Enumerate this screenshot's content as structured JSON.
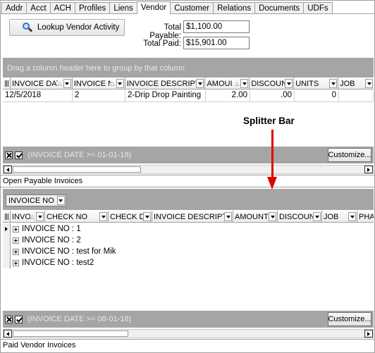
{
  "tabs": [
    {
      "label": "Addr",
      "active": false
    },
    {
      "label": "Acct",
      "active": false
    },
    {
      "label": "ACH",
      "active": false
    },
    {
      "label": "Profiles",
      "active": false
    },
    {
      "label": "Liens",
      "active": false
    },
    {
      "label": "Vendor",
      "active": true
    },
    {
      "label": "Customer",
      "active": false
    },
    {
      "label": "Relations",
      "active": false
    },
    {
      "label": "Documents",
      "active": false
    },
    {
      "label": "UDFs",
      "active": false
    }
  ],
  "lookup_button": {
    "label": "Lookup Vendor Activity",
    "icon": "magnifier-icon"
  },
  "totals": {
    "payable_label": "Total Payable:",
    "payable_value": "$1,100.00",
    "paid_label": "Total Paid:",
    "paid_value": "$15,901.00"
  },
  "annotation": {
    "label": "Splitter Bar",
    "arrow_color": "#e00000"
  },
  "payable_grid": {
    "group_hint": "Drag a column header here to group by that column",
    "columns": [
      "INVOICE DATE",
      "INVOICE N",
      "INVOICE DESCRIPTIC",
      "AMOUI",
      "DISCOUN",
      "UNITS",
      "JOB"
    ],
    "rows": [
      [
        "12/5/2018",
        "2",
        "2-Drip Drop Painting",
        "2.00",
        ".00",
        "0",
        ""
      ]
    ],
    "filter_text": "(INVOICE DATE >= 01-01-18)",
    "customize_label": "Customize...",
    "caption": "Open Payable Invoices"
  },
  "paid_grid": {
    "group_chip": "INVOICE NO",
    "columns": [
      "INVOICE D",
      "CHECK NO",
      "CHECK DA",
      "INVOICE DESCRIPTIO",
      "AMOUNT",
      "DISCOUN",
      "JOB",
      "PHA"
    ],
    "groups": [
      "INVOICE NO : 1",
      "INVOICE NO : 2",
      "INVOICE NO : test for Mik",
      "INVOICE NO : test2"
    ],
    "filter_text": "(INVOICE DATE >= 08-01-18)",
    "customize_label": "Customize...",
    "caption": "Paid Vendor Invoices"
  },
  "colors": {
    "panel_gray": "#a5a5a5",
    "accent_red": "#e00000"
  }
}
